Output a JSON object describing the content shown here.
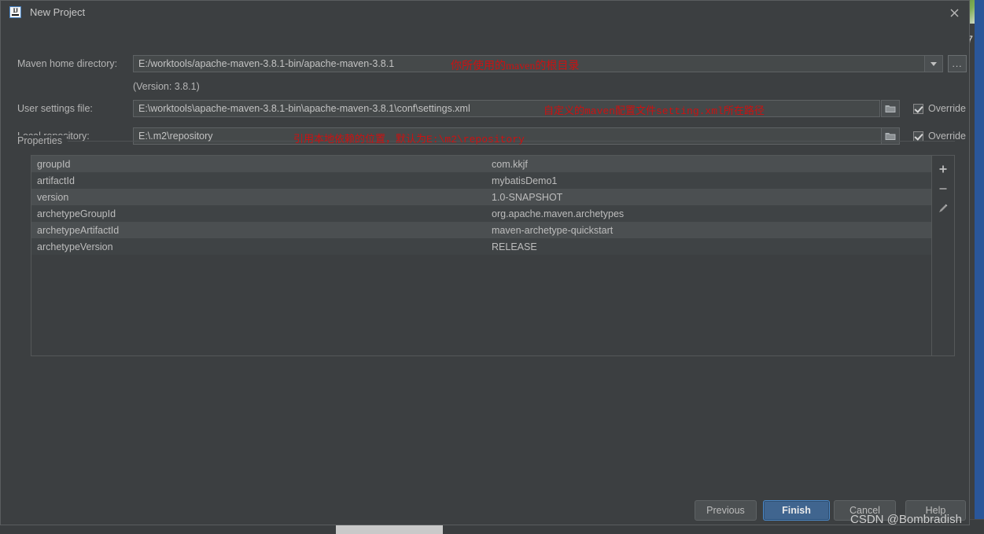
{
  "window": {
    "title": "New Project",
    "app_icon": "intellij-idea-icon",
    "close_icon": "close-icon"
  },
  "form": {
    "maven_home": {
      "label": "Maven home directory:",
      "value": "E:/worktools/apache-maven-3.8.1-bin/apache-maven-3.8.1",
      "dropdown_icon": "chevron-down-icon",
      "browse_label": "...",
      "annotation": "你所使用的maven的根目录"
    },
    "version_note": "(Version: 3.8.1)",
    "user_settings": {
      "label": "User settings file:",
      "value": "E:\\worktools\\apache-maven-3.8.1-bin\\apache-maven-3.8.1\\conf\\settings.xml",
      "browse_icon": "folder-icon",
      "override_label": "Override",
      "override_checked": true,
      "annotation": "自定义的maven配置文件setting.xml所在路径"
    },
    "local_repository": {
      "label": "Local repository:",
      "value": "E:\\.m2\\repository",
      "browse_icon": "folder-icon",
      "override_label": "Override",
      "override_checked": true,
      "annotation": "引用本地依赖的位置，默认为E:\\m2\\repository"
    }
  },
  "properties": {
    "group_label": "Properties",
    "rows": [
      {
        "key": "groupId",
        "value": "com.kkjf"
      },
      {
        "key": "artifactId",
        "value": "mybatisDemo1"
      },
      {
        "key": "version",
        "value": "1.0-SNAPSHOT"
      },
      {
        "key": "archetypeGroupId",
        "value": "org.apache.maven.archetypes"
      },
      {
        "key": "archetypeArtifactId",
        "value": "maven-archetype-quickstart"
      },
      {
        "key": "archetypeVersion",
        "value": "RELEASE"
      }
    ],
    "toolbar": {
      "add_icon": "plus-icon",
      "remove_icon": "minus-icon",
      "edit_icon": "pencil-icon"
    }
  },
  "footer": {
    "previous": "Previous",
    "finish": "Finish",
    "cancel": "Cancel",
    "help": "Help"
  },
  "watermark": "CSDN @Bombradish",
  "colors": {
    "dialog_bg": "#3c3f41",
    "field_bg": "#45494a",
    "accent_blue": "#40658f",
    "annotation_red": "#cc1111",
    "row_stripe": "#4b4f51"
  },
  "desktop": {
    "edge_digit": "7"
  }
}
